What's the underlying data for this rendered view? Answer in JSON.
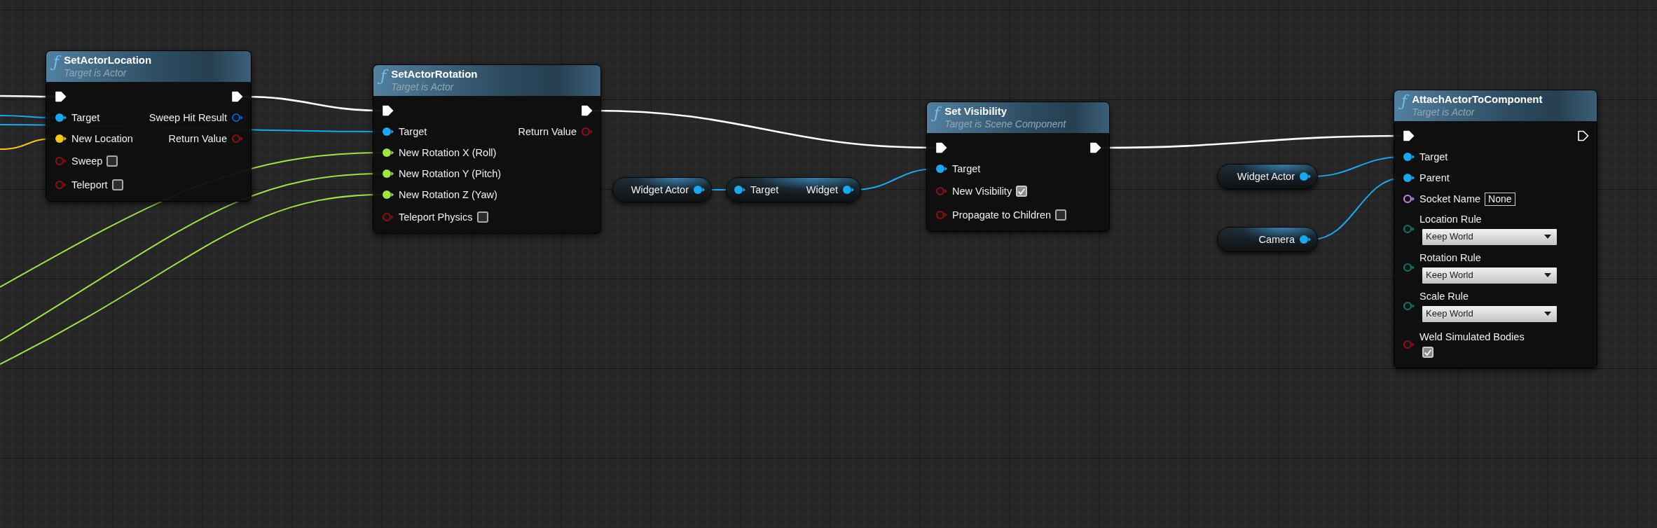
{
  "nodes": [
    {
      "kind": "function",
      "icon": "ƒ",
      "title": "SetActorLocation",
      "subtitle": "Target is Actor",
      "inputs": [
        {
          "kind": "exec",
          "connected": true
        },
        {
          "kind": "object",
          "label": "Target",
          "connected": true
        },
        {
          "kind": "vector",
          "label": "New Location",
          "connected": true
        },
        {
          "kind": "bool",
          "label": "Sweep",
          "connected": false,
          "control": {
            "kind": "checkbox",
            "checked": false
          }
        },
        {
          "kind": "bool",
          "label": "Teleport",
          "connected": false,
          "control": {
            "kind": "checkbox",
            "checked": false
          }
        }
      ],
      "outputs": [
        {
          "kind": "exec",
          "connected": true
        },
        {
          "kind": "struct",
          "label": "Sweep Hit Result",
          "connected": false
        },
        {
          "kind": "bool",
          "label": "Return Value",
          "connected": false
        }
      ]
    },
    {
      "kind": "function",
      "icon": "ƒ",
      "title": "SetActorRotation",
      "subtitle": "Target is Actor",
      "inputs": [
        {
          "kind": "exec",
          "connected": true
        },
        {
          "kind": "object",
          "label": "Target",
          "connected": true
        },
        {
          "kind": "float",
          "label": "New Rotation X (Roll)",
          "connected": true
        },
        {
          "kind": "float",
          "label": "New Rotation Y (Pitch)",
          "connected": true
        },
        {
          "kind": "float",
          "label": "New Rotation Z (Yaw)",
          "connected": true
        },
        {
          "kind": "bool",
          "label": "Teleport Physics",
          "connected": false,
          "control": {
            "kind": "checkbox",
            "checked": false
          }
        }
      ],
      "outputs": [
        {
          "kind": "exec",
          "connected": true
        },
        {
          "kind": "bool",
          "label": "Return Value",
          "connected": false
        }
      ]
    },
    {
      "kind": "variable",
      "label": "Widget Actor",
      "pin": {
        "kind": "object",
        "connected": true
      }
    },
    {
      "kind": "getter",
      "input": "Target",
      "output": "Widget",
      "pin": {
        "kind": "object",
        "connected": true
      }
    },
    {
      "kind": "function",
      "icon": "ƒ",
      "title": "Set Visibility",
      "subtitle": "Target is Scene Component",
      "inputs": [
        {
          "kind": "exec",
          "connected": true
        },
        {
          "kind": "object",
          "label": "Target",
          "connected": true
        },
        {
          "kind": "bool",
          "label": "New Visibility",
          "connected": false,
          "control": {
            "kind": "checkbox",
            "checked": true
          }
        },
        {
          "kind": "bool",
          "label": "Propagate to Children",
          "connected": false,
          "control": {
            "kind": "checkbox",
            "checked": false
          }
        }
      ],
      "outputs": [
        {
          "kind": "exec",
          "connected": true
        }
      ]
    },
    {
      "kind": "variable",
      "label": "Widget Actor",
      "pin": {
        "kind": "object",
        "connected": true
      }
    },
    {
      "kind": "variable",
      "label": "Camera",
      "pin": {
        "kind": "object",
        "connected": true
      }
    },
    {
      "kind": "function",
      "icon": "ƒ",
      "title": "AttachActorToComponent",
      "subtitle": "Target is Actor",
      "inputs": [
        {
          "kind": "exec",
          "connected": true
        },
        {
          "kind": "object",
          "label": "Target",
          "connected": true
        },
        {
          "kind": "object",
          "label": "Parent",
          "connected": true
        },
        {
          "kind": "name",
          "label": "Socket Name",
          "connected": false,
          "control": {
            "kind": "text",
            "value": "None"
          }
        },
        {
          "kind": "enum",
          "label": "Location Rule",
          "connected": false,
          "control": {
            "kind": "dropdown",
            "value": "Keep World"
          }
        },
        {
          "kind": "enum",
          "label": "Rotation Rule",
          "connected": false,
          "control": {
            "kind": "dropdown",
            "value": "Keep World"
          }
        },
        {
          "kind": "enum",
          "label": "Scale Rule",
          "connected": false,
          "control": {
            "kind": "dropdown",
            "value": "Keep World"
          }
        },
        {
          "kind": "bool",
          "label": "Weld Simulated Bodies",
          "connected": false,
          "control": {
            "kind": "checkbox",
            "checked": true
          }
        }
      ],
      "outputs": [
        {
          "kind": "exec",
          "connected": false
        }
      ]
    }
  ]
}
